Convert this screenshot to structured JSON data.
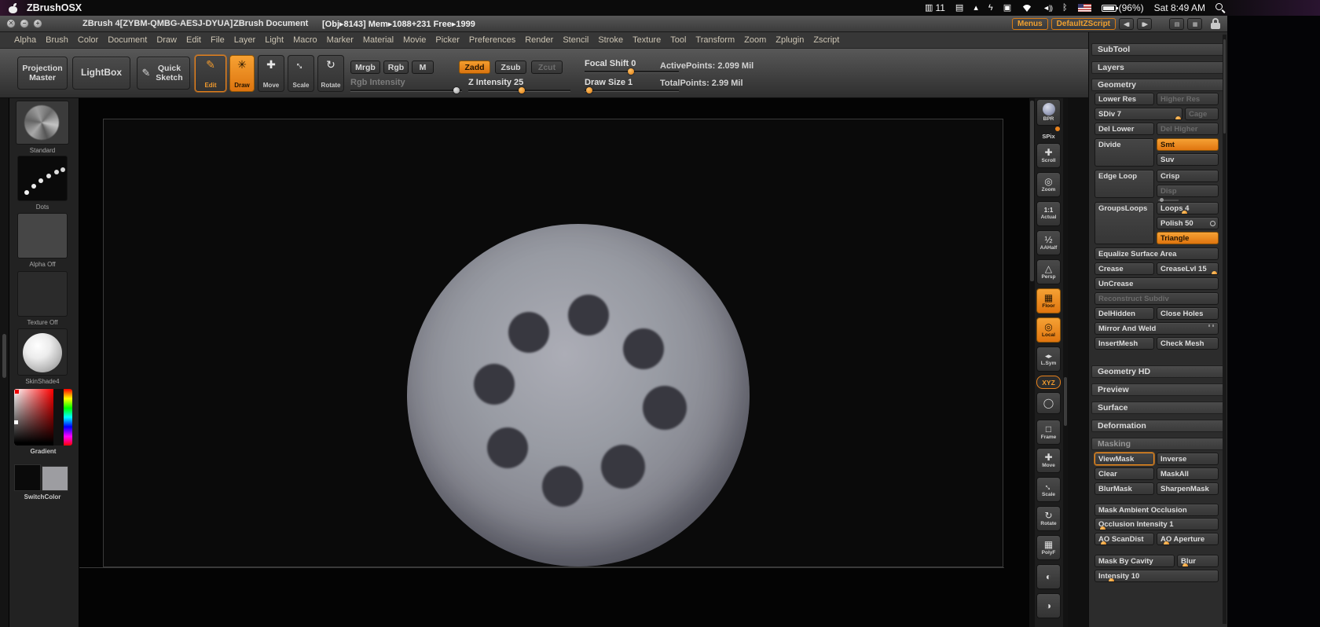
{
  "macbar": {
    "app": "ZBrushOSX",
    "input_count": "11",
    "battery": "(96%)",
    "clock": "Sat 8:49 AM"
  },
  "titlebar": {
    "app_title": "ZBrush 4[ZYBM-QMBG-AESJ-DYUA]",
    "doc_title": "ZBrush Document",
    "stats": "[Obj▸8143] Mem▸1088+231 Free▸1999",
    "menus_button": "Menus",
    "zscript_button": "DefaultZScript"
  },
  "menus": [
    "Alpha",
    "Brush",
    "Color",
    "Document",
    "Draw",
    "Edit",
    "File",
    "Layer",
    "Light",
    "Macro",
    "Marker",
    "Material",
    "Movie",
    "Picker",
    "Preferences",
    "Render",
    "Stencil",
    "Stroke",
    "Texture",
    "Tool",
    "Transform",
    "Zoom",
    "Zplugin",
    "Zscript"
  ],
  "toolbar": {
    "projection_master": "Projection Master",
    "lightbox": "LightBox",
    "quick_sketch": "Quick Sketch",
    "edit": "Edit",
    "draw": "Draw",
    "move": "Move",
    "scale": "Scale",
    "rotate": "Rotate",
    "mrgb": "Mrgb",
    "rgb": "Rgb",
    "m": "M",
    "zadd": "Zadd",
    "zsub": "Zsub",
    "zcut": "Zcut",
    "rgb_intensity": "Rgb Intensity",
    "z_intensity": "Z Intensity 25",
    "focal_shift": "Focal Shift 0",
    "draw_size": "Draw Size 1",
    "active_points": "ActivePoints: 2.099 Mil",
    "total_points": "TotalPoints: 2.99 Mil"
  },
  "left_tray": {
    "brush": "Standard",
    "stroke": "Dots",
    "alpha": "Alpha Off",
    "texture": "Texture Off",
    "material": "SkinShade4",
    "gradient": "Gradient",
    "switch_color": "SwitchColor"
  },
  "right_strip": {
    "bpr": "BPR",
    "spix": "SPix",
    "scroll": "Scroll",
    "zoom": "Zoom",
    "actual": "Actual",
    "aahalf": "AAHalf",
    "persp": "Persp",
    "floor": "Floor",
    "local": "Local",
    "lsym": "L.Sym",
    "xyz": "XYZ",
    "frame": "Frame",
    "move": "Move",
    "scale": "Scale",
    "rotate": "Rotate",
    "polyf": "PolyF"
  },
  "tool_panel": {
    "subtool": "SubTool",
    "layers": "Layers",
    "geometry": "Geometry",
    "lower_res": "Lower Res",
    "higher_res": "Higher Res",
    "sdiv": "SDiv 7",
    "cage": "Cage",
    "del_lower": "Del Lower",
    "del_higher": "Del Higher",
    "divide": "Divide",
    "smt": "Smt",
    "suv": "Suv",
    "edge_loop": "Edge Loop",
    "crisp": "Crisp",
    "disp": "Disp",
    "groupsloops": "GroupsLoops",
    "loops": "Loops 4",
    "polish": "Polish 50",
    "triangle": "Triangle",
    "equalize": "Equalize Surface Area",
    "crease": "Crease",
    "creaselvl": "CreaseLvl 15",
    "uncrease": "UnCrease",
    "reconstruct": "Reconstruct Subdiv",
    "delhidden": "DelHidden",
    "close_holes": "Close Holes",
    "mirror_weld": "Mirror And Weld",
    "insertmesh": "InsertMesh",
    "check_mesh": "Check Mesh",
    "geometry_hd": "Geometry HD",
    "preview": "Preview",
    "surface": "Surface",
    "deformation": "Deformation",
    "masking": "Masking",
    "viewmask": "ViewMask",
    "inverse": "Inverse",
    "clear": "Clear",
    "maskall": "MaskAll",
    "blurmask": "BlurMask",
    "sharpenmask": "SharpenMask",
    "mask_ao": "Mask Ambient Occlusion",
    "occlusion_intensity": "Occlusion Intensity 1",
    "ao_scandist": "AO ScanDist",
    "ao_aperture": "AO Aperture",
    "mask_by_cavity": "Mask By Cavity",
    "blur": "Blur",
    "intensity": "Intensity 10"
  }
}
